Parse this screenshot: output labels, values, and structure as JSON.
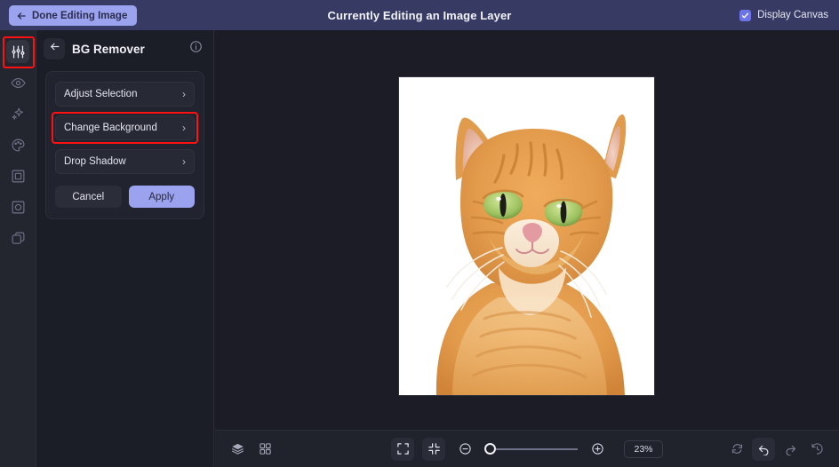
{
  "topbar": {
    "done_button": "Done Editing Image",
    "back_arrow_icon": "arrow-left-icon",
    "title": "Currently Editing an Image Layer",
    "display_canvas_label": "Display Canvas",
    "display_canvas_checked": true,
    "bg_color": "#373a63",
    "accent_color": "#9ba2ee"
  },
  "rail": {
    "items": [
      {
        "icon": "sliders-adjust-icon",
        "name": "adjust",
        "active": true,
        "highlighted": true
      },
      {
        "icon": "eye-icon",
        "name": "visibility",
        "active": false,
        "highlighted": false
      },
      {
        "icon": "sparkles-icon",
        "name": "effects",
        "active": false,
        "highlighted": false
      },
      {
        "icon": "palette-icon",
        "name": "color",
        "active": false,
        "highlighted": false
      },
      {
        "icon": "frame-icon",
        "name": "frame",
        "active": false,
        "highlighted": false
      },
      {
        "icon": "vignette-icon",
        "name": "vignette",
        "active": false,
        "highlighted": false
      },
      {
        "icon": "duplicate-layers-icon",
        "name": "duplicate",
        "active": false,
        "highlighted": false
      }
    ],
    "highlight_color": "#ff1111"
  },
  "panel": {
    "back_icon": "arrow-left-icon",
    "title": "BG Remover",
    "info_icon": "info-circle-icon",
    "options": [
      {
        "label": "Adjust Selection",
        "chevron": "›",
        "highlighted": false
      },
      {
        "label": "Change Background",
        "chevron": "›",
        "highlighted": true
      },
      {
        "label": "Drop Shadow",
        "chevron": "›",
        "highlighted": false
      }
    ],
    "cancel_label": "Cancel",
    "apply_label": "Apply",
    "apply_color": "#9ba2ee"
  },
  "canvas": {
    "image_subject": "orange tabby cat portrait on white background",
    "background": "#ffffff"
  },
  "bottombar": {
    "left_tools": [
      {
        "icon": "layers-icon",
        "name": "layers"
      },
      {
        "icon": "grid-icon",
        "name": "grid"
      }
    ],
    "center_tools": [
      {
        "icon": "fit-screen-icon",
        "name": "fit-screen",
        "boxed": true
      },
      {
        "icon": "shrink-icon",
        "name": "shrink-to-fit",
        "boxed": true
      }
    ],
    "zoom_out_icon": "zoom-out-icon",
    "zoom_in_icon": "zoom-in-icon",
    "zoom_level": "23%",
    "slider_position_pct": 2,
    "right_tools": [
      {
        "icon": "reset-icon",
        "name": "reset",
        "boxed": false
      },
      {
        "icon": "undo-icon",
        "name": "undo",
        "boxed": true
      },
      {
        "icon": "redo-icon",
        "name": "redo",
        "boxed": false
      },
      {
        "icon": "history-icon",
        "name": "history",
        "boxed": false
      }
    ]
  }
}
